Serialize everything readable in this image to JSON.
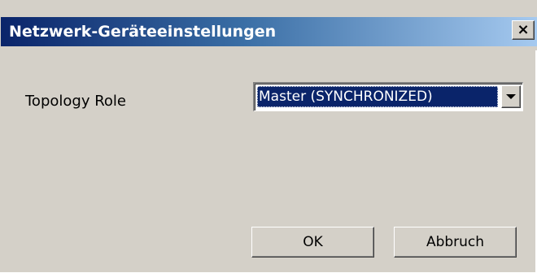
{
  "dialog": {
    "title": "Netzwerk-Geräteeinstellungen",
    "close_glyph": "×"
  },
  "form": {
    "topology_role_label": "Topology Role",
    "topology_role_value": "Master (SYNCHRONIZED)"
  },
  "buttons": {
    "ok_label": "OK",
    "cancel_label": "Abbruch"
  },
  "icons": {
    "close": "close-icon",
    "dropdown": "chevron-down-icon"
  },
  "colors": {
    "titlebar_start": "#0a246a",
    "titlebar_end": "#a6caf0",
    "window_face": "#d4d0c8",
    "selection": "#0a246a"
  }
}
